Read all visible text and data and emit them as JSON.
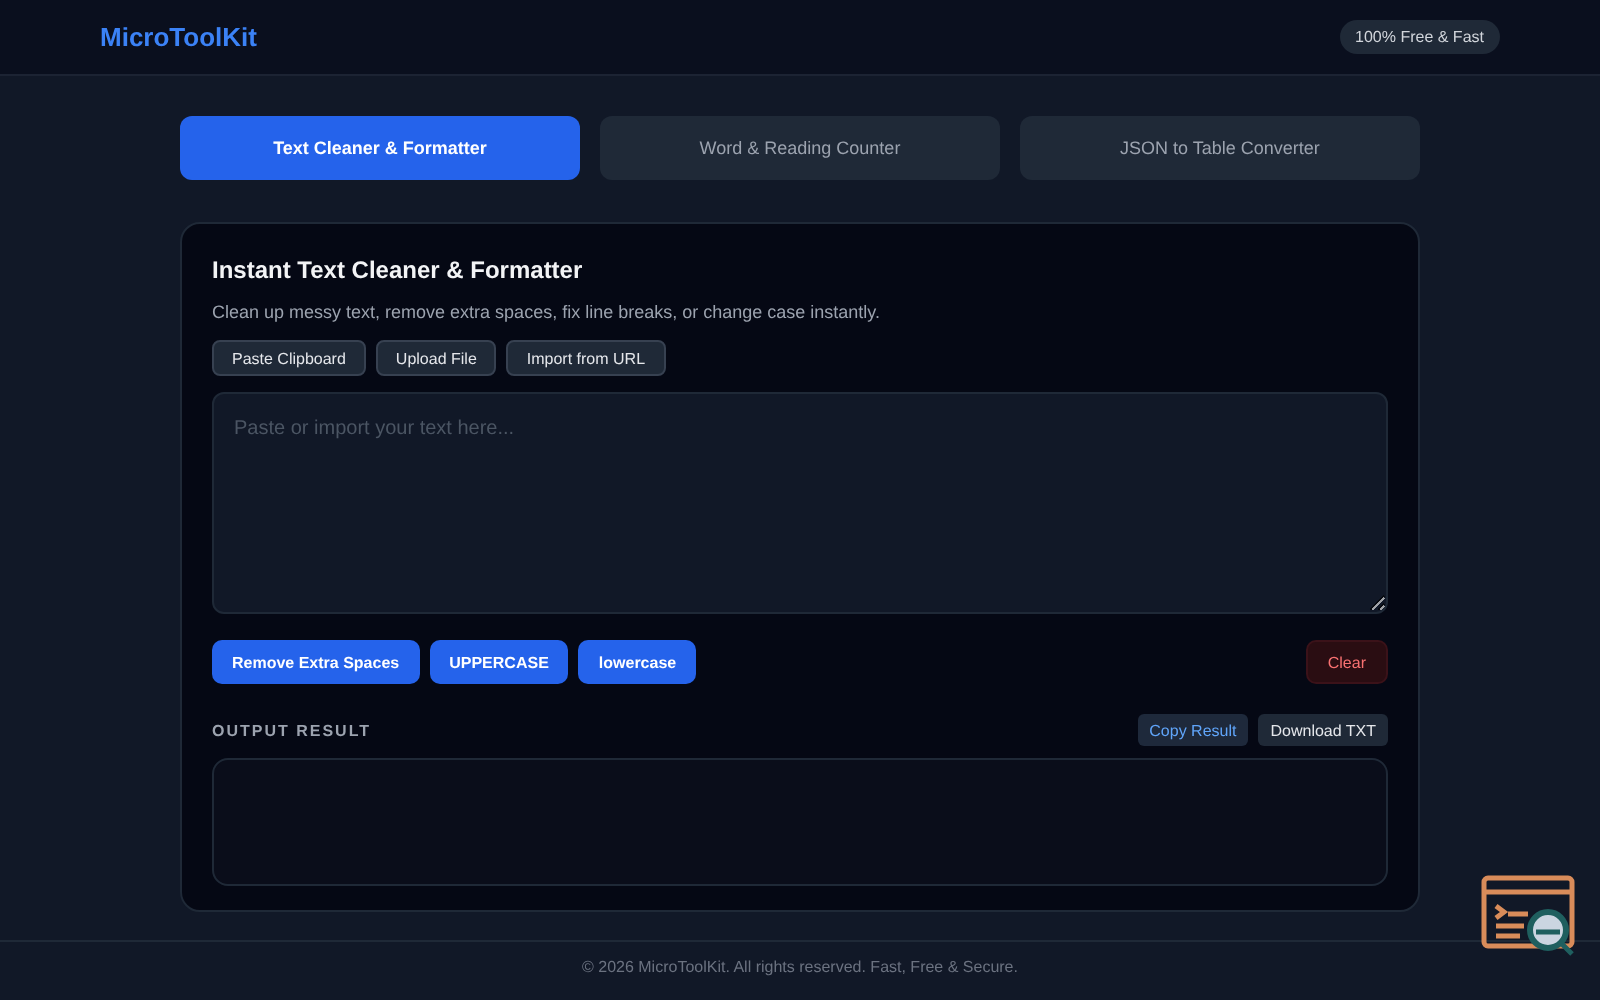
{
  "header": {
    "logo": "MicroToolKit",
    "badge": "100% Free & Fast"
  },
  "tabs": [
    {
      "label": "Text Cleaner & Formatter",
      "selected": true
    },
    {
      "label": "Word & Reading Counter",
      "selected": false
    },
    {
      "label": "JSON to Table Converter",
      "selected": false
    }
  ],
  "card": {
    "title": "Instant Text Cleaner & Formatter",
    "description": "Clean up messy text, remove extra spaces, fix line breaks, or change case instantly.",
    "import_buttons": [
      "Paste Clipboard",
      "Upload File",
      "Import from URL"
    ],
    "input": {
      "placeholder": "Paste or import your text here..."
    },
    "actions": [
      {
        "label": "Remove Extra Spaces",
        "kind": "primary"
      },
      {
        "label": "UPPERCASE",
        "kind": "primary"
      },
      {
        "label": "lowercase",
        "kind": "primary"
      },
      {
        "label": "Clear",
        "kind": "danger"
      }
    ],
    "output_label": "OUTPUT RESULT",
    "output_buttons": [
      {
        "label": "Copy Result",
        "kind": "accent"
      },
      {
        "label": "Download TXT",
        "kind": "plain"
      }
    ]
  },
  "footer": {
    "text": "© 2026 MicroToolKit. All rights reserved. Fast, Free & Secure."
  }
}
